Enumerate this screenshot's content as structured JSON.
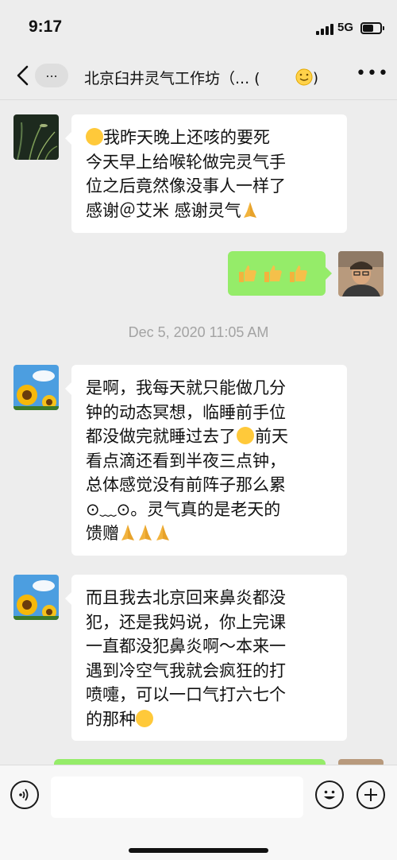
{
  "status_bar": {
    "time": "9:17",
    "network": "5G"
  },
  "header": {
    "back_label": "...",
    "title": "北京臼井灵气工作坊（... ("
  },
  "messages": [
    {
      "side": "left",
      "avatar": "grass-photo-avatar",
      "line1": "我昨天晚上还咳的要死",
      "line2": "今天早上给喉轮做完灵气手",
      "line3": "位之后竟然像没事人一样了",
      "line4": "感谢＠艾米 感谢灵气"
    },
    {
      "side": "right",
      "avatar": "man-photo-avatar",
      "content": "thumbs-up x3"
    },
    {
      "side": "left",
      "avatar": "sunflower-avatar",
      "line1": "是啊，我每天就只能做几分",
      "line2": "钟的动态冥想，临睡前手位",
      "line3": "都没做完就睡过去了",
      "line3b": "前天",
      "line4": "看点滴还看到半夜三点钟，",
      "line5": "总体感觉没有前阵子那么累",
      "line6": "⊙﹏⊙。灵气真的是老天的",
      "line7": "馈赠"
    },
    {
      "side": "left",
      "avatar": "sunflower-avatar",
      "line1": "而且我去北京回来鼻炎都没",
      "line2": "犯，还是我妈说，你上完课",
      "line3": "一直都没犯鼻炎啊～本来一",
      "line4": "遇到冷空气我就会疯狂的打",
      "line5": "喷嚏，可以一口气打六七个",
      "line6": "的那种"
    }
  ],
  "timestamp": "Dec 5, 2020 11:05 AM",
  "colors": {
    "self_bubble": "#95ec69",
    "other_bubble": "#ffffff",
    "background": "#ededed"
  }
}
